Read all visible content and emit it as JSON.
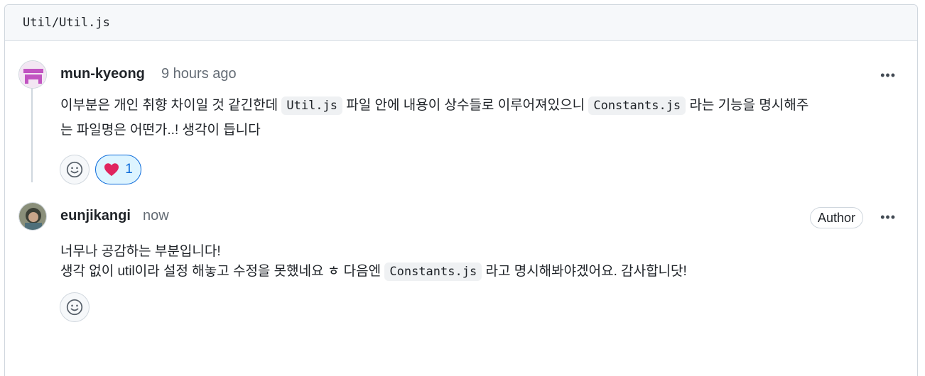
{
  "file": {
    "path": "Util/Util.js"
  },
  "comments": [
    {
      "author": "mun-kyeong",
      "time": "9 hours ago",
      "menu_label": "•••",
      "body": {
        "line1_part1": "이부분은 개인 취향 차이일 것 같긴한데",
        "line1_code1": "Util.js",
        "line1_part2": "파일 안에 내용이 상수들로 이루어져있으니",
        "line1_code2": "Constants.js",
        "line1_part3": "라는 기능을 명시해주",
        "line2": "는 파일명은 어떤가..! 생각이 듭니다"
      },
      "reactions": [
        {
          "emoji": "heart",
          "count": "1"
        }
      ]
    },
    {
      "author": "eunjikangi",
      "time": "now",
      "badge": "Author",
      "menu_label": "•••",
      "body": {
        "line1": "너무나 공감하는 부분입니다!",
        "line2_part1": "생각 없이 util이라 설정 해놓고 수정을 못했네요 ㅎ 다음엔",
        "line2_code": "Constants.js",
        "line2_part2": "라고 명시해봐야겠어요. 감사합니닷!"
      }
    }
  ],
  "colors": {
    "accent": "#0969da",
    "reaction_bg": "#ddf4ff",
    "avatar1": "#c154c1",
    "heart": "#e0245e"
  }
}
